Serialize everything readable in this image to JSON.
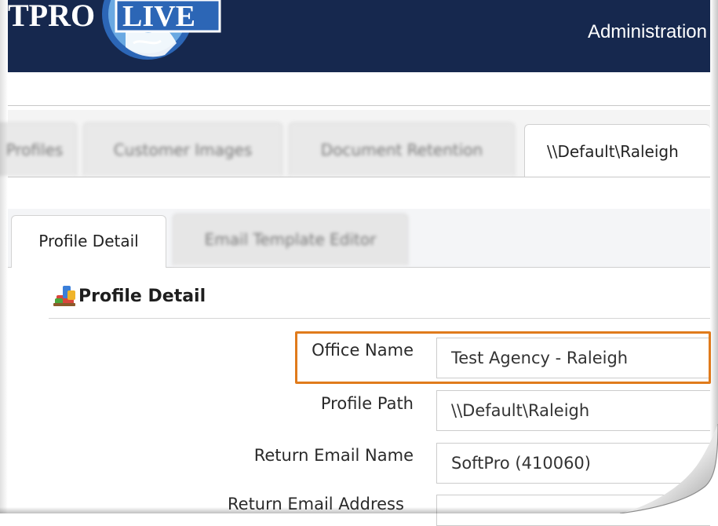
{
  "header": {
    "logo_text": "TPRO LIVE",
    "title": "Administration"
  },
  "main_tabs": [
    {
      "label": "Profiles",
      "active": false
    },
    {
      "label": "Customer Images",
      "active": false
    },
    {
      "label": "Document Retention",
      "active": false
    },
    {
      "label": "\\\\Default\\Raleigh",
      "active": true
    }
  ],
  "sub_tabs": [
    {
      "label": "Profile Detail",
      "active": true
    },
    {
      "label": "Email Template Editor",
      "active": false
    }
  ],
  "section": {
    "title": "Profile Detail",
    "icon": "profile-stack-icon"
  },
  "fields": [
    {
      "label": "Office Name",
      "value": "Test Agency - Raleigh",
      "highlighted": true
    },
    {
      "label": "Profile Path",
      "value": "\\\\Default\\Raleigh"
    },
    {
      "label": "Return Email Name",
      "value": "SoftPro (410060)"
    },
    {
      "label": "Return Email Address",
      "value": ""
    }
  ],
  "colors": {
    "header_bg": "#16284e",
    "highlight": "#e07b1c"
  }
}
